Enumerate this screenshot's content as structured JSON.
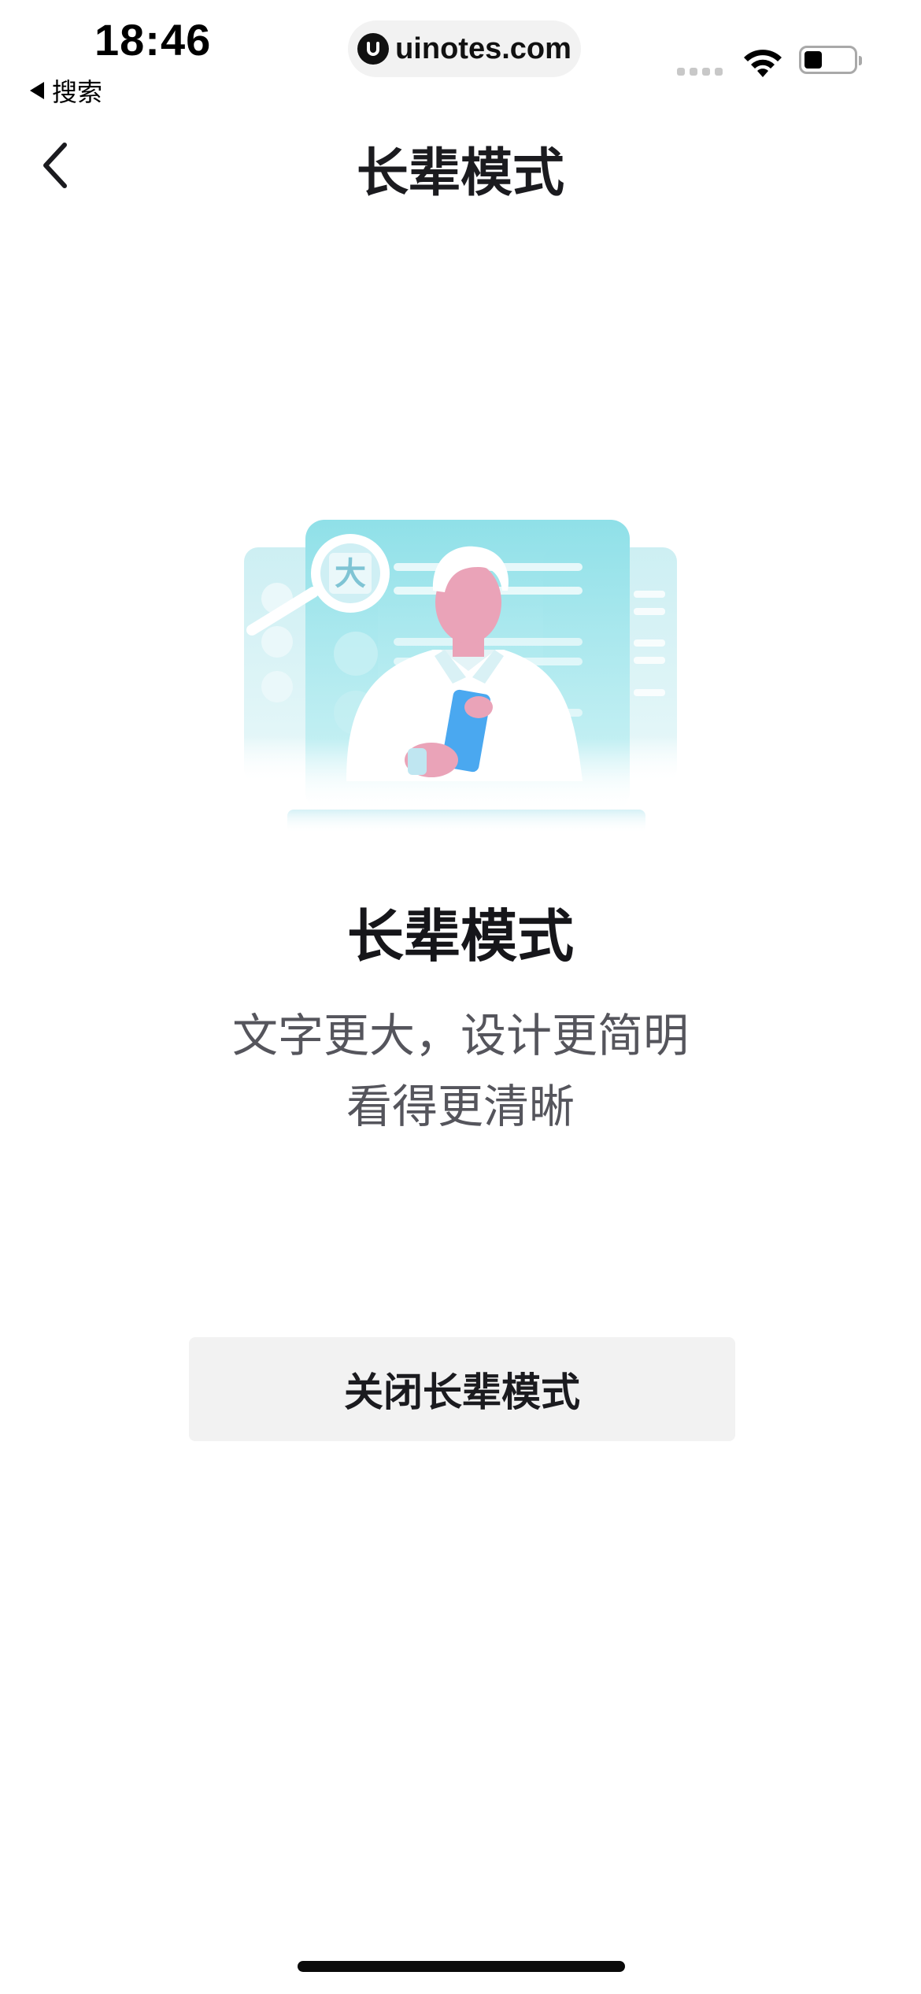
{
  "status_bar": {
    "time": "18:46",
    "back_app_label": "搜索",
    "watermark": "uinotes.com",
    "battery_level": 0.35
  },
  "nav": {
    "title": "长辈模式",
    "back_icon": "chevron-left-icon"
  },
  "content": {
    "illustration_badge": "大",
    "title": "长辈模式",
    "description_line1": "文字更大，设计更简明",
    "description_line2": "看得更清晰"
  },
  "actions": {
    "close_button_label": "关闭长辈模式"
  },
  "colors": {
    "illustration_teal": "#8fe0e8",
    "button_bg": "#f2f2f2",
    "title_text": "#16161a",
    "desc_text": "#55555c",
    "phone_blue": "#4aa8f0",
    "skin_pink": "#eaa3b8"
  }
}
